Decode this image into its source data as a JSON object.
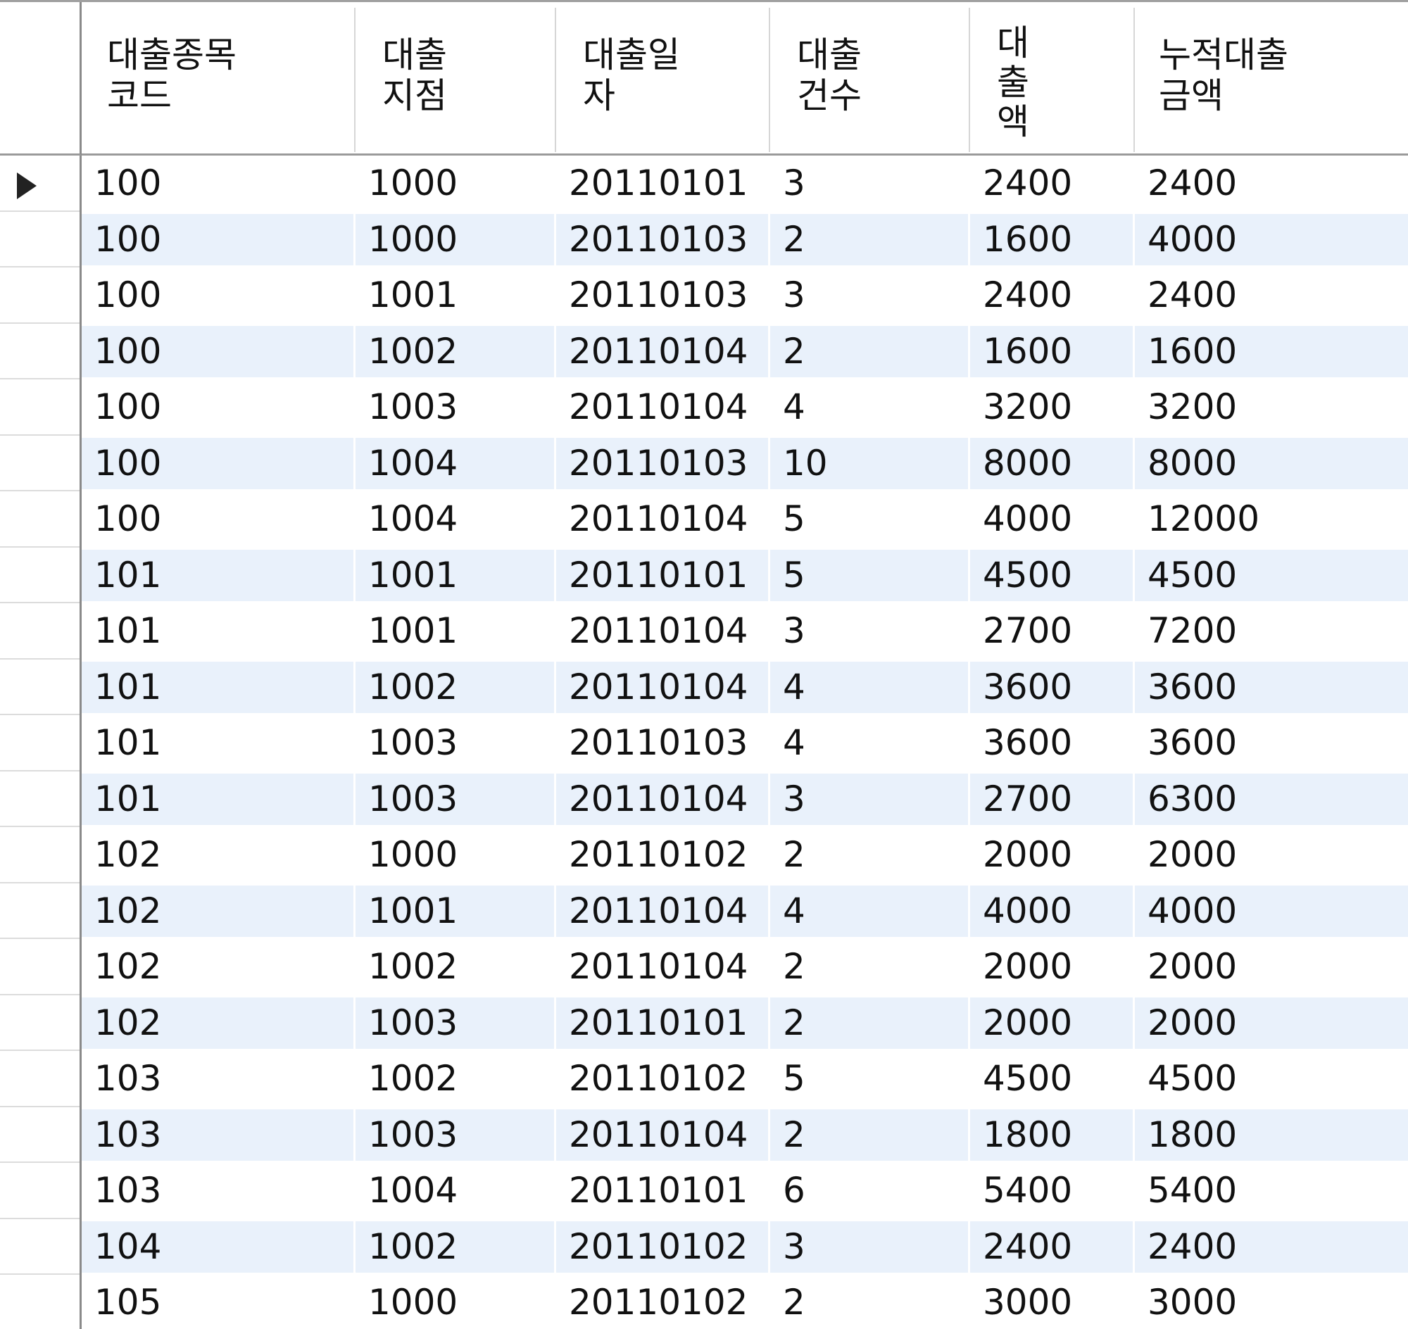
{
  "columns": [
    {
      "label": "대출종목\n코드"
    },
    {
      "label": "대출\n지점"
    },
    {
      "label": "대출일\n자"
    },
    {
      "label": "대출\n건수"
    },
    {
      "label": "대\n출\n액"
    },
    {
      "label": "누적대출\n금액"
    }
  ],
  "rows": [
    [
      "100",
      "1000",
      "20110101",
      "3",
      "2400",
      "2400"
    ],
    [
      "100",
      "1000",
      "20110103",
      "2",
      "1600",
      "4000"
    ],
    [
      "100",
      "1001",
      "20110103",
      "3",
      "2400",
      "2400"
    ],
    [
      "100",
      "1002",
      "20110104",
      "2",
      "1600",
      "1600"
    ],
    [
      "100",
      "1003",
      "20110104",
      "4",
      "3200",
      "3200"
    ],
    [
      "100",
      "1004",
      "20110103",
      "10",
      "8000",
      "8000"
    ],
    [
      "100",
      "1004",
      "20110104",
      "5",
      "4000",
      "12000"
    ],
    [
      "101",
      "1001",
      "20110101",
      "5",
      "4500",
      "4500"
    ],
    [
      "101",
      "1001",
      "20110104",
      "3",
      "2700",
      "7200"
    ],
    [
      "101",
      "1002",
      "20110104",
      "4",
      "3600",
      "3600"
    ],
    [
      "101",
      "1003",
      "20110103",
      "4",
      "3600",
      "3600"
    ],
    [
      "101",
      "1003",
      "20110104",
      "3",
      "2700",
      "6300"
    ],
    [
      "102",
      "1000",
      "20110102",
      "2",
      "2000",
      "2000"
    ],
    [
      "102",
      "1001",
      "20110104",
      "4",
      "4000",
      "4000"
    ],
    [
      "102",
      "1002",
      "20110104",
      "2",
      "2000",
      "2000"
    ],
    [
      "102",
      "1003",
      "20110101",
      "2",
      "2000",
      "2000"
    ],
    [
      "103",
      "1002",
      "20110102",
      "5",
      "4500",
      "4500"
    ],
    [
      "103",
      "1003",
      "20110104",
      "2",
      "1800",
      "1800"
    ],
    [
      "103",
      "1004",
      "20110101",
      "6",
      "5400",
      "5400"
    ],
    [
      "104",
      "1002",
      "20110102",
      "3",
      "2400",
      "2400"
    ],
    [
      "105",
      "1000",
      "20110102",
      "2",
      "3000",
      "3000"
    ]
  ],
  "current_row": 0
}
